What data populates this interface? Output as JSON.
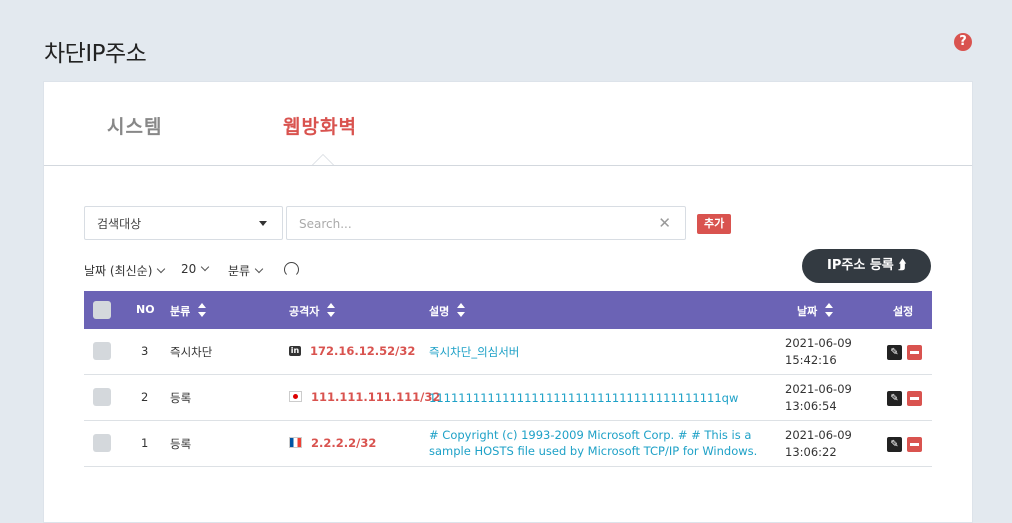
{
  "page": {
    "title": "차단IP주소",
    "help_icon": "?"
  },
  "tabs": [
    {
      "label": "시스템",
      "active": false
    },
    {
      "label": "웹방화벽",
      "active": true
    }
  ],
  "search": {
    "target_label": "검색대상",
    "placeholder": "Search...",
    "clear_icon": "✕",
    "add_label": "추가"
  },
  "filters": {
    "sort_label": "날짜 (최신순)",
    "page_size": "20",
    "category_label": "분류"
  },
  "register_button": {
    "label": "IP주소 등록 ⮭"
  },
  "table": {
    "headers": {
      "no": "NO",
      "category": "분류",
      "attacker": "공격자",
      "description": "설명",
      "date": "날짜",
      "settings": "설정"
    },
    "rows": [
      {
        "no": "3",
        "category": "즉시차단",
        "flag": "linkedin-icon",
        "flag_glyph": "in",
        "ip": "172.16.12.52/32",
        "description": "즉시차단_의심서버",
        "date": "2021-06-09",
        "time": "15:42:16"
      },
      {
        "no": "2",
        "category": "등록",
        "flag": "japan-flag-icon",
        "flag_glyph": "",
        "ip": "111.111.111.111/32",
        "description": "1111111111111111111111111111111111111111qw",
        "date": "2021-06-09",
        "time": "13:06:54"
      },
      {
        "no": "1",
        "category": "등록",
        "flag": "france-flag-icon",
        "flag_glyph": "",
        "ip": "2.2.2.2/32",
        "description": "# Copyright (c) 1993-2009 Microsoft Corp. # # This is a sample HOSTS file used by Microsoft TCP/IP for Windows.",
        "date": "2021-06-09",
        "time": "13:06:22"
      }
    ]
  },
  "colors": {
    "accent_red": "#d9534f",
    "table_header": "#6b63b5",
    "link_blue": "#1ea1c7",
    "dark_button": "#333a41"
  }
}
